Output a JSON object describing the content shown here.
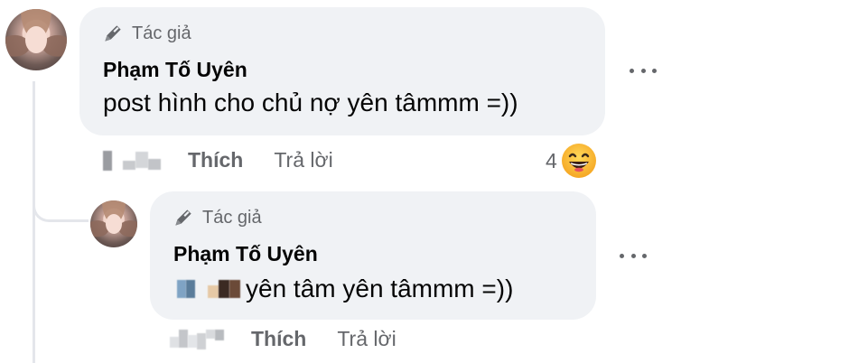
{
  "comment": {
    "author_badge": "Tác giả",
    "author_name": "Phạm Tố Uyên",
    "text": "post hình cho chủ nợ yên tâmmm =))",
    "actions": {
      "like": "Thích",
      "reply": "Trả lời"
    },
    "reaction_count": "4",
    "reaction_icon": "laughing-emoji-icon"
  },
  "reply": {
    "author_badge": "Tác giả",
    "author_name": "Phạm Tố Uyên",
    "text": "yên tâm yên tâmmm =))",
    "actions": {
      "like": "Thích",
      "reply": "Trả lời"
    }
  },
  "colors": {
    "bubble": "#f0f2f5",
    "secondary_text": "#65676b",
    "primary_text": "#050505",
    "thread_line": "#e4e6eb",
    "emoji": "#f7b928"
  }
}
